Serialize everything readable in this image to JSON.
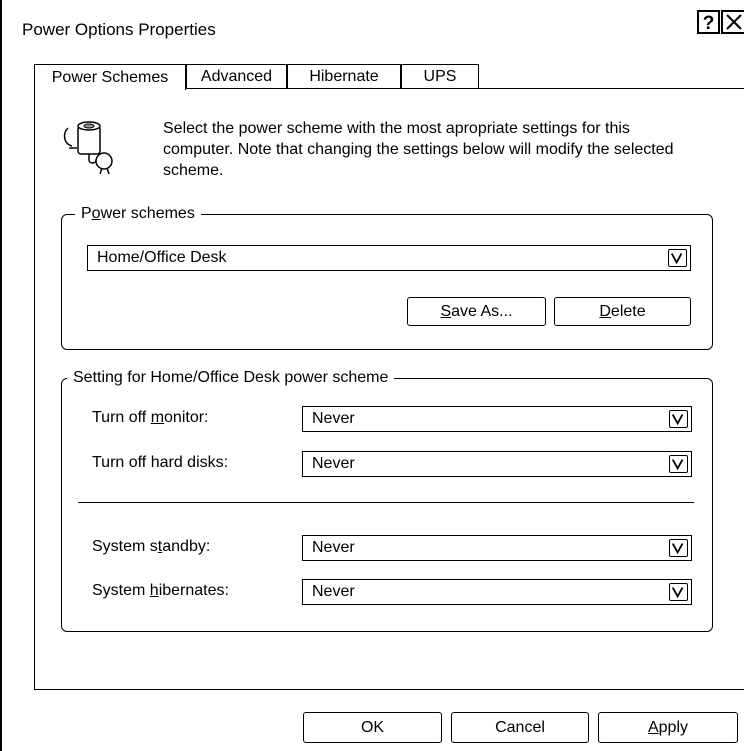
{
  "window": {
    "title": "Power Options Properties"
  },
  "tabs": [
    {
      "label": "Power Schemes",
      "active": true
    },
    {
      "label": "Advanced",
      "active": false
    },
    {
      "label": "Hibernate",
      "active": false
    },
    {
      "label": "UPS",
      "active": false
    }
  ],
  "description": "Select the power scheme with the most apropriate settings for this computer. Note that changing the settings below will modify the selected scheme.",
  "power_schemes": {
    "legend_pre": "P",
    "legend_accel": "o",
    "legend_post": "wer schemes",
    "selected": "Home/Office Desk",
    "save_as_accel": "S",
    "save_as_rest": "ave As...",
    "delete_accel": "D",
    "delete_rest": "elete"
  },
  "settings": {
    "legend": "Setting for Home/Office Desk power scheme",
    "monitor": {
      "pre": "Turn off ",
      "accel": "m",
      "post": "onitor:",
      "value": "Never"
    },
    "disks": {
      "pre": "Turn off hard disks:",
      "accel": "",
      "post": "",
      "value": "Never"
    },
    "standby": {
      "pre": "System s",
      "accel": "t",
      "post": "andby:",
      "value": "Never"
    },
    "hibernate": {
      "pre": "System ",
      "accel": "h",
      "post": "ibernates:",
      "value": "Never"
    }
  },
  "buttons": {
    "ok": "OK",
    "cancel": "Cancel",
    "apply_accel": "A",
    "apply_rest": "pply"
  },
  "icons": [
    "help-icon",
    "close-icon",
    "power-plug-icon",
    "dropdown-arrow-icon"
  ]
}
